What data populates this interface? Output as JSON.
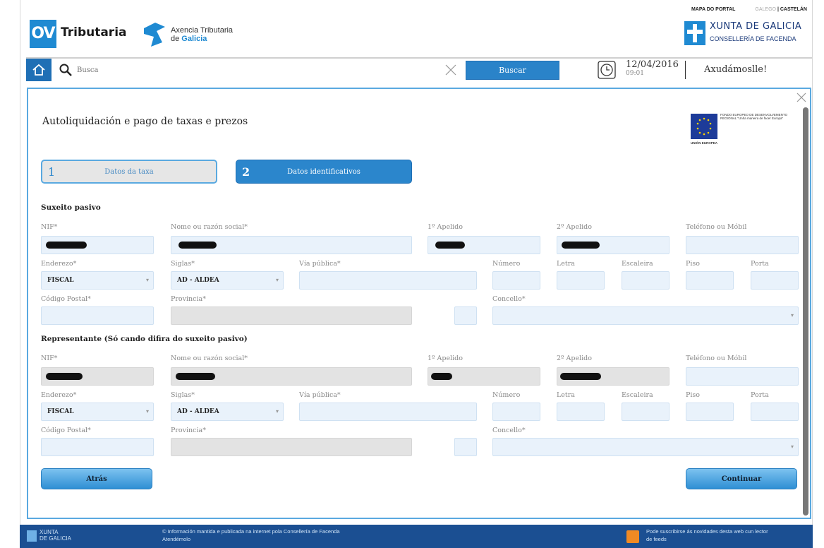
{
  "header": {
    "ov_badge": "OV",
    "ov_text": "Tributaria",
    "atg_line1": "Axencia Tributaria",
    "atg_line2_pre": "de ",
    "atg_line2_brand": "Galicia",
    "top_links": {
      "map": "MAPA DO PORTAL",
      "lang_gl": "GALEGO",
      "sep": "|",
      "lang_es": "CASTELÁN"
    },
    "xunta_title": "XUNTA DE GALICIA",
    "xunta_sub": "CONSELLERÍA DE FACENDA"
  },
  "searchbar": {
    "placeholder": "Busca",
    "button": "Buscar",
    "date": "12/04/2016",
    "time": "09:01",
    "help": "Axudámoslle!"
  },
  "dialog": {
    "title": "Autoliquidación e pago de taxas e prezos",
    "eu_text": "FONDO EUROPEO DE DESENVOLVEMENTO REGIONAL \"Unha maneira de facer Europa\"",
    "eu_label": "UNIÓN EUROPEA",
    "steps": [
      {
        "num": "1",
        "label": "Datos da taxa"
      },
      {
        "num": "2",
        "label": "Datos identificativos"
      }
    ],
    "suxeito": {
      "section": "Suxeito pasivo",
      "labels": {
        "nif": "NIF*",
        "nome": "Nome ou razón social*",
        "apelido1": "1º Apelido",
        "apelido2": "2º Apelido",
        "telefono": "Teléfono ou Móbil",
        "enderezo": "Enderezo*",
        "siglas": "Siglas*",
        "via": "Vía pública*",
        "numero": "Número",
        "letra": "Letra",
        "escaleira": "Escaleira",
        "piso": "Piso",
        "porta": "Porta",
        "cp": "Código Postal*",
        "provincia": "Provincia*",
        "concello": "Concello*"
      },
      "enderezo_value": "FISCAL",
      "siglas_value": "AD - ALDEA"
    },
    "representante": {
      "section": "Representante (Só cando difira do suxeito pasivo)",
      "labels": {
        "nif": "NIF*",
        "nome": "Nome ou razón social*",
        "apelido1": "1º Apelido",
        "apelido2": "2º Apelido",
        "telefono": "Teléfono ou Móbil",
        "enderezo": "Enderezo*",
        "siglas": "Siglas*",
        "via": "Vía pública*",
        "numero": "Número",
        "letra": "Letra",
        "escaleira": "Escaleira",
        "piso": "Piso",
        "porta": "Porta",
        "cp": "Código Postal*",
        "provincia": "Provincia*",
        "concello": "Concello*"
      },
      "enderezo_value": "FISCAL",
      "siglas_value": "AD - ALDEA"
    },
    "back_button": "Atrás",
    "continue_button": "Continuar"
  },
  "footer": {
    "xunta_line1": "XUNTA",
    "xunta_line2": "DE GALICIA",
    "info_line1": "© Información mantida e publicada na internet pola Consellería de Facenda",
    "info_line2": "Atendémolo",
    "rss_line1": "Pode suscribirse ás novidades desta web cun lector",
    "rss_line2": "de feeds"
  },
  "colors": {
    "accent": "#2b86cc",
    "field_bg": "#e9f2fb",
    "footer_bg": "#1b4f92"
  },
  "icons": [
    "home-icon",
    "search-icon",
    "clear-icon",
    "clock-icon",
    "close-icon",
    "rss-icon"
  ]
}
